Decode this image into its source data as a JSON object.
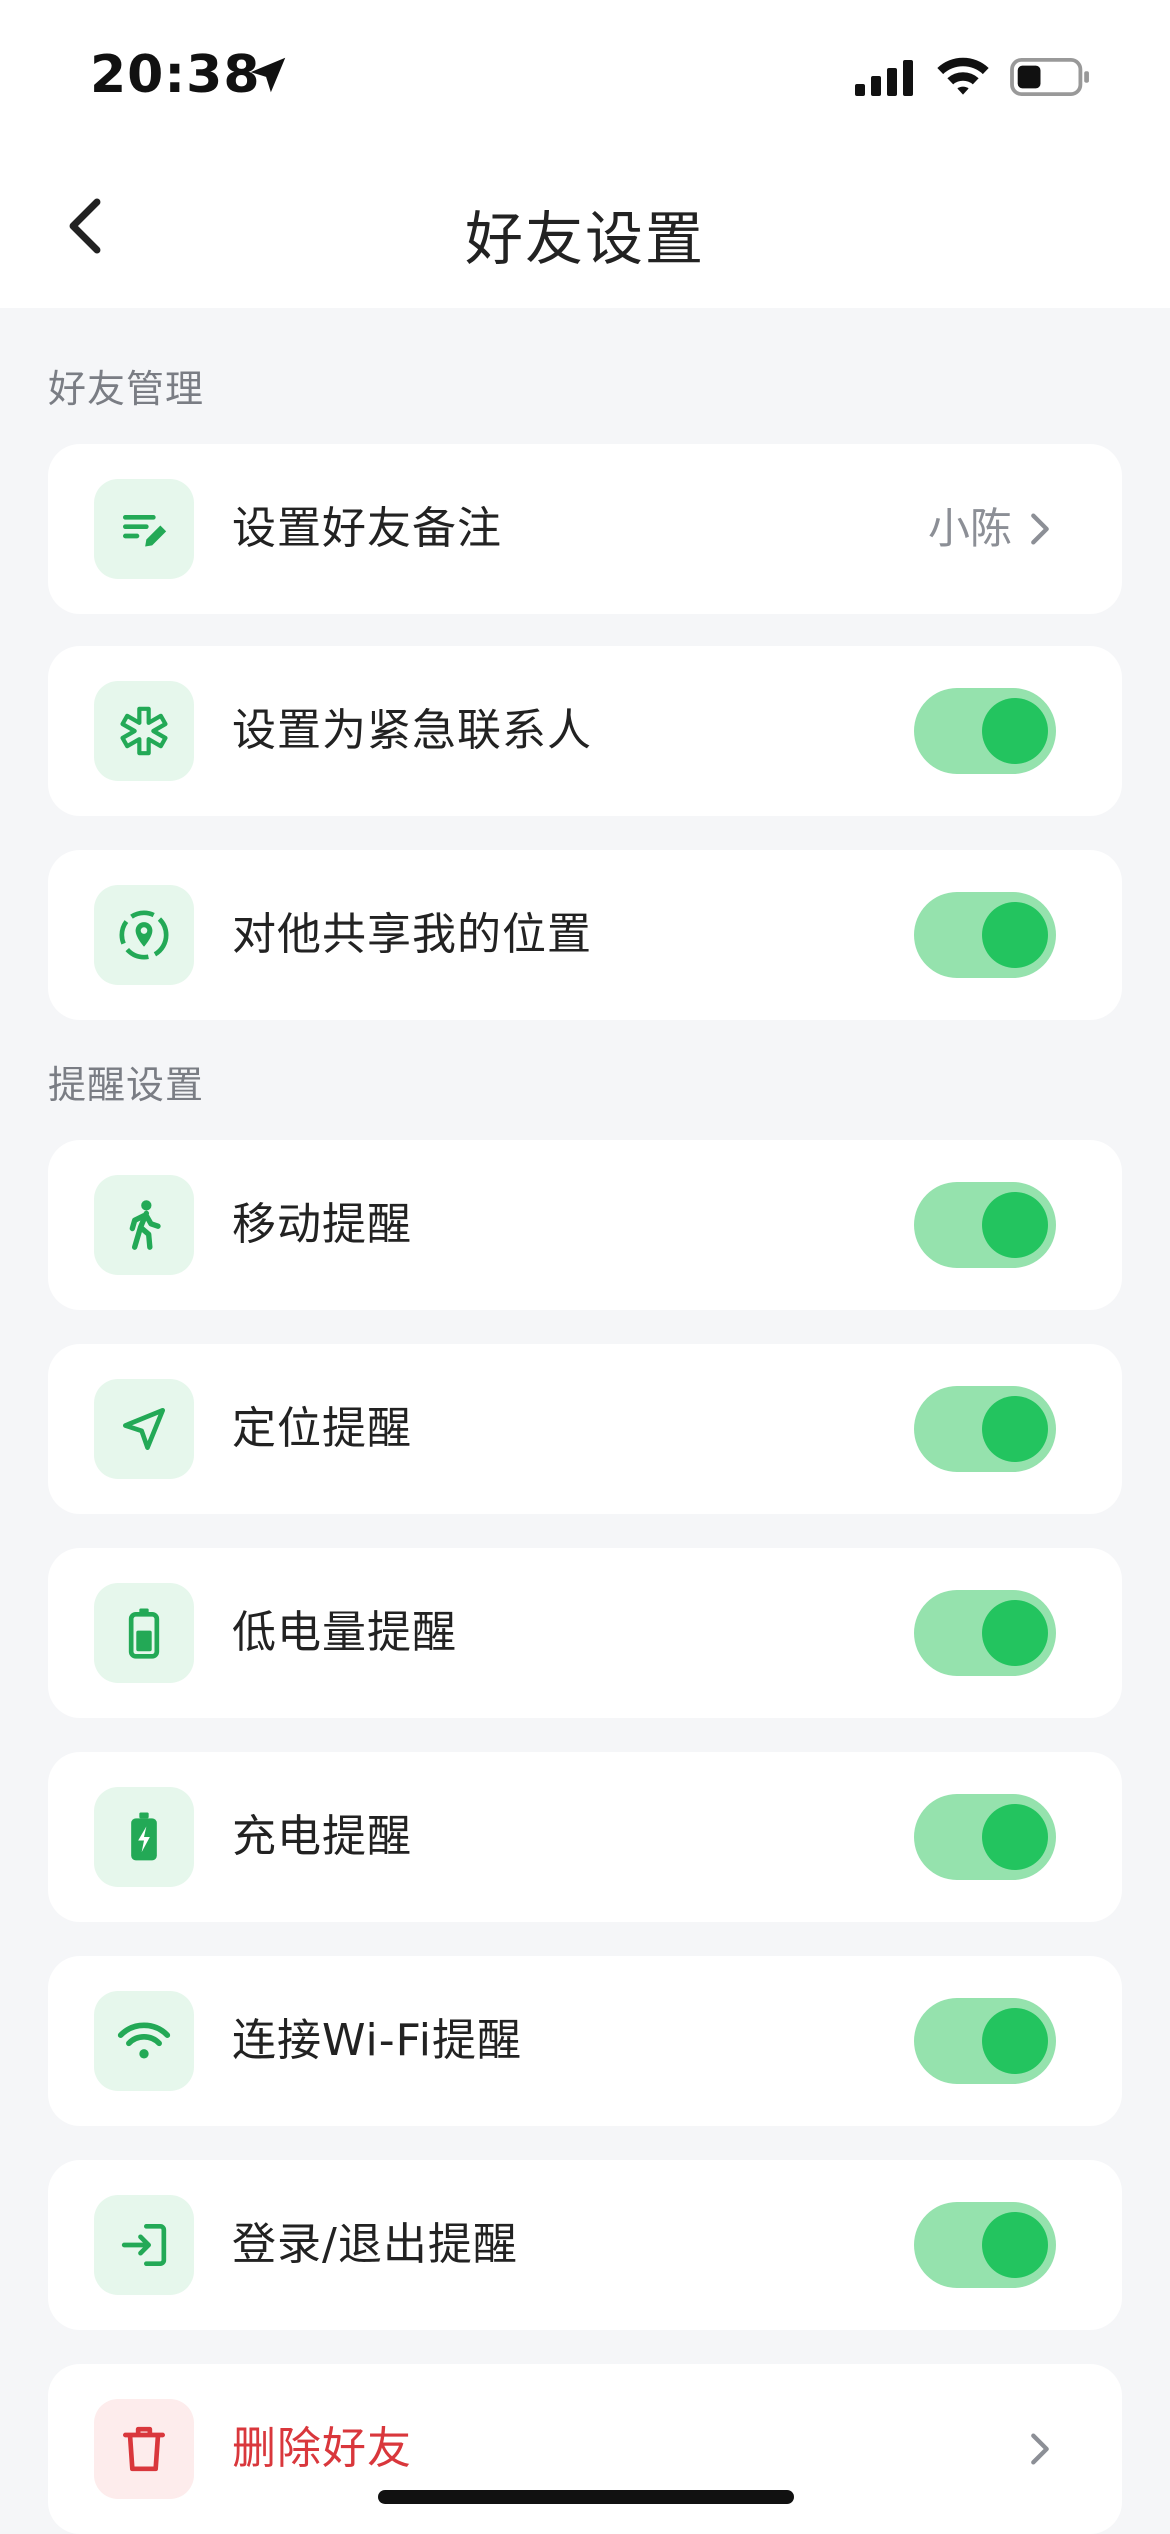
{
  "status_bar": {
    "time": "20:38"
  },
  "nav": {
    "title": "好友设置",
    "back_icon": "chevron-left-icon"
  },
  "sections": {
    "friend_management": {
      "title": "好友管理",
      "remark": {
        "label": "设置好友备注",
        "value": "小陈",
        "icon": "edit-note-icon"
      },
      "emergency": {
        "label": "设置为紧急联系人",
        "icon": "medical-star-icon",
        "enabled": true
      },
      "share_location": {
        "label": "对他共享我的位置",
        "icon": "location-share-icon",
        "enabled": true
      }
    },
    "reminders": {
      "title": "提醒设置",
      "movement": {
        "label": "移动提醒",
        "icon": "walking-person-icon",
        "enabled": true
      },
      "location": {
        "label": "定位提醒",
        "icon": "navigation-arrow-icon",
        "enabled": true
      },
      "low_battery": {
        "label": "低电量提醒",
        "icon": "battery-icon",
        "enabled": true
      },
      "charging": {
        "label": "充电提醒",
        "icon": "battery-charging-icon",
        "enabled": true
      },
      "wifi": {
        "label": "连接Wi-Fi提醒",
        "icon": "wifi-icon",
        "enabled": true
      },
      "login": {
        "label": "登录/退出提醒",
        "icon": "login-icon",
        "enabled": true
      }
    }
  },
  "delete_friend": {
    "label": "删除好友",
    "icon": "trash-icon"
  },
  "colors": {
    "accent": "#23c45f",
    "toggle_track": "#95e2ad",
    "icon_bg": "#e6f7ec",
    "danger": "#d9373c",
    "page_bg": "#f5f6f8"
  }
}
